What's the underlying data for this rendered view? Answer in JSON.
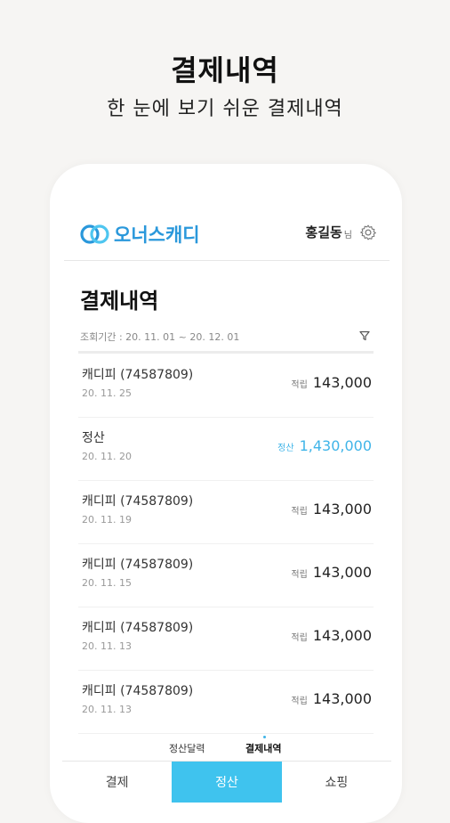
{
  "promo": {
    "title": "결제내역",
    "subtitle": "한 눈에 보기 쉬운 결제내역"
  },
  "header": {
    "logo_text": "오너스캐디",
    "user_name": "홍길동",
    "user_suffix": "님",
    "settings_icon": "gear-icon"
  },
  "page": {
    "title": "결제내역",
    "period_label": "조회기간 : 20. 11. 01 ~ 20. 12. 01",
    "filter_icon": "filter-icon"
  },
  "transactions": [
    {
      "name": "캐디피 (74587809)",
      "date": "20. 11. 25",
      "tag": "적립",
      "amount": "143,000",
      "type": "earn"
    },
    {
      "name": "정산",
      "date": "20. 11. 20",
      "tag": "정산",
      "amount": "1,430,000",
      "type": "settle"
    },
    {
      "name": "캐디피 (74587809)",
      "date": "20. 11. 19",
      "tag": "적립",
      "amount": "143,000",
      "type": "earn"
    },
    {
      "name": "캐디피 (74587809)",
      "date": "20. 11. 15",
      "tag": "적립",
      "amount": "143,000",
      "type": "earn"
    },
    {
      "name": "캐디피 (74587809)",
      "date": "20. 11. 13",
      "tag": "적립",
      "amount": "143,000",
      "type": "earn"
    },
    {
      "name": "캐디피 (74587809)",
      "date": "20. 11. 13",
      "tag": "적립",
      "amount": "143,000",
      "type": "earn"
    }
  ],
  "subtabs": {
    "calendar": "정산달력",
    "history": "결제내역"
  },
  "bottom_nav": {
    "payment": "결제",
    "settlement": "정산",
    "shopping": "쇼핑"
  },
  "colors": {
    "accent": "#3fc3ee",
    "brand": "#2a98db"
  }
}
